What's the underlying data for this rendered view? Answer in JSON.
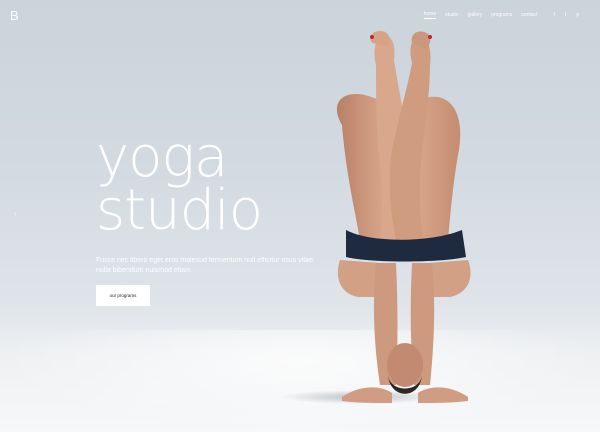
{
  "brand": {
    "logo": "B"
  },
  "nav": {
    "links": [
      "home",
      "studio",
      "gallery",
      "programs",
      "contact"
    ],
    "social": [
      {
        "icon": "facebook-icon",
        "glyph": "f"
      },
      {
        "icon": "twitter-icon",
        "glyph": "t"
      },
      {
        "icon": "pinterest-icon",
        "glyph": "p"
      }
    ]
  },
  "hero": {
    "title_line1": "yoga",
    "title_line2": "studio",
    "subtitle": "Fusce nec libero eget eros malesud fermentum null efficitur risus vitae nulla bibendum euismod etiam",
    "cta_label": "our programs",
    "slider_prev": "‹"
  },
  "colors": {
    "background": "#d3dae1",
    "text": "#ffffff",
    "button_bg": "#ffffff",
    "swimsuit": "#1e2a3f",
    "skin": "#d8a58a"
  }
}
